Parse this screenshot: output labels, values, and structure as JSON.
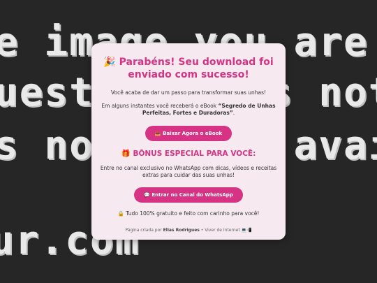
{
  "background": {
    "line1": "e image you are",
    "line2": "uesting does not ex",
    "line3": "s no longer availab",
    "line4": "ur.com"
  },
  "card": {
    "title_emoji": "🎉",
    "title": "Parabéns! Seu download foi enviado com sucesso!",
    "intro": "Você acaba de dar um passo para transformar suas unhas!",
    "ebook_prefix": "Em alguns instantes você receberá o eBook ",
    "ebook_name": "“Segredo de Unhas Perfeitas, Fortes e Duradoras”",
    "ebook_suffix": ".",
    "download_button_emoji": "📥",
    "download_button": "Baixar Agora o eBook",
    "bonus_emoji": "🎁",
    "bonus_title": "BÔNUS ESPECIAL PARA VOCÊ:",
    "bonus_text": "Entre no canal exclusivo no WhatsApp com dicas, vídeos e receitas extras para cuidar das suas unhas!",
    "whatsapp_button_emoji": "💬",
    "whatsapp_button": "Entrar no Canal do WhatsApp",
    "free_emoji": "🔒",
    "free_text": "Tudo 100% gratuito e feito com carinho para você!",
    "footer_prefix": "Página criada por ",
    "footer_author": "Elias Rodrigues",
    "footer_suffix": " • Viver de Internet 💻📲"
  },
  "colors": {
    "accent": "#d63384",
    "card_bg": "#f6e9ef",
    "page_bg": "#262626"
  }
}
